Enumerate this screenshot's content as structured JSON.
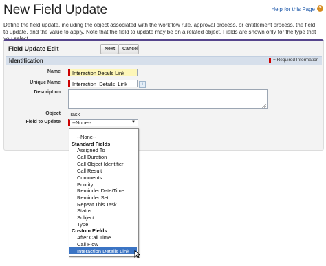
{
  "page": {
    "title": "New Field Update",
    "help_link": "Help for this Page",
    "help_badge": "?",
    "description": "Define the field update, including the object associated with the workflow rule, approval process, or entitlement process, the field to update, and the value to apply. Note that the field to update may be on a related object. Fields are shown only for the type that you select."
  },
  "panel": {
    "title": "Field Update Edit",
    "next_label": "Next",
    "cancel_label": "Cancel",
    "section_title": "Identification",
    "required_legend": "= Required Information"
  },
  "form": {
    "name_label": "Name",
    "name_value": "Interaction Details Link",
    "unique_name_label": "Unique Name",
    "unique_name_value": "Interaction_Details_Link",
    "info_icon": "i",
    "description_label": "Description",
    "description_value": "",
    "object_label": "Object",
    "object_value": "Task",
    "field_to_update_label": "Field to Update",
    "field_to_update_value": "--None--",
    "select_arrow": "▼"
  },
  "dropdown": {
    "none_option": "--None--",
    "standard_group": "Standard Fields",
    "standard_fields": [
      "Assigned To",
      "Call Duration",
      "Call Object Identifier",
      "Call Result",
      "Comments",
      "Priority",
      "Reminder Date/Time",
      "Reminder Set",
      "Repeat This Task",
      "Status",
      "Subject",
      "Type"
    ],
    "custom_group": "Custom Fields",
    "custom_fields": [
      "After Call Time",
      "Call Flow",
      "Interaction Details Link"
    ],
    "highlighted": "Interaction Details Link"
  },
  "colors": {
    "accent": "#56458c",
    "required": "#cc0000",
    "selection": "#3b74c4",
    "section_bar": "#d6dfeb"
  }
}
